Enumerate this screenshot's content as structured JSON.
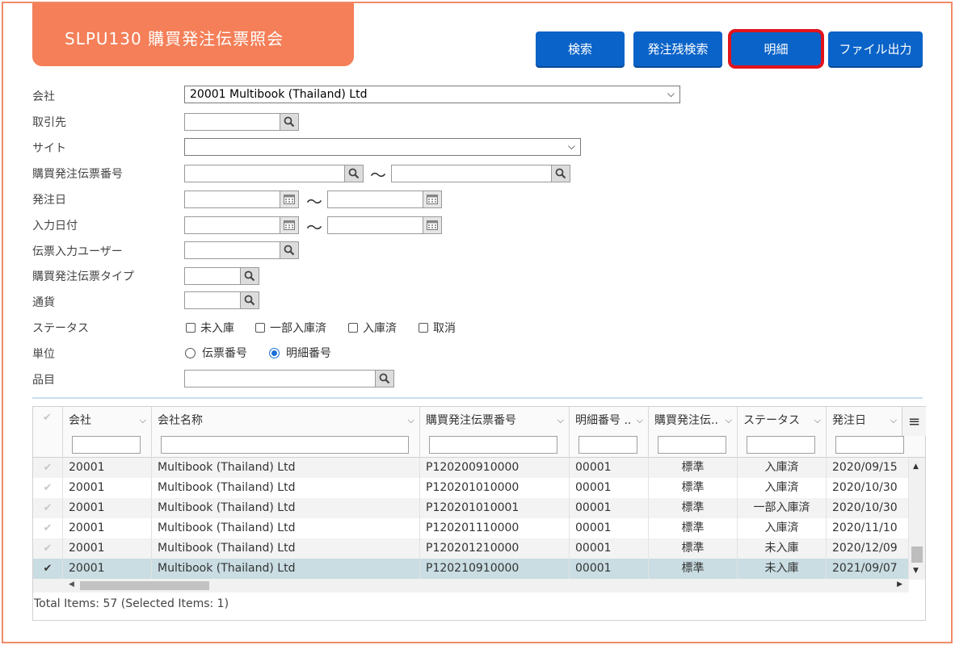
{
  "title": "SLPU130 購買発注伝票照会",
  "toolbar": {
    "search": "検索",
    "remaining_search": "発注残検索",
    "detail": "明細",
    "file_output": "ファイル出力"
  },
  "form": {
    "company_label": "会社",
    "company_value": "20001 Multibook (Thailand) Ltd",
    "supplier_label": "取引先",
    "site_label": "サイト",
    "po_number_label": "購買発注伝票番号",
    "order_date_label": "発注日",
    "entry_date_label": "入力日付",
    "entry_user_label": "伝票入力ユーザー",
    "po_type_label": "購買発注伝票タイプ",
    "currency_label": "通貨",
    "status_label": "ステータス",
    "status_options": [
      "未入庫",
      "一部入庫済",
      "入庫済",
      "取消"
    ],
    "unit_label": "単位",
    "unit_options": [
      "伝票番号",
      "明細番号"
    ],
    "unit_selected": "明細番号",
    "item_label": "品目",
    "range_sep": "〜"
  },
  "grid": {
    "columns": [
      "会社",
      "会社名称",
      "購買発注伝票番号",
      "明細番号 ..",
      "購買発注伝..",
      "ステータス",
      "発注日"
    ],
    "rows": [
      {
        "company": "20001",
        "name": "Multibook (Thailand) Ltd",
        "po": "P120200910000",
        "line": "00001",
        "type": "標準",
        "status": "入庫済",
        "date": "2020/09/15",
        "selected": false
      },
      {
        "company": "20001",
        "name": "Multibook (Thailand) Ltd",
        "po": "P120201010000",
        "line": "00001",
        "type": "標準",
        "status": "入庫済",
        "date": "2020/10/30",
        "selected": false
      },
      {
        "company": "20001",
        "name": "Multibook (Thailand) Ltd",
        "po": "P120201010001",
        "line": "00001",
        "type": "標準",
        "status": "一部入庫済",
        "date": "2020/10/30",
        "selected": false
      },
      {
        "company": "20001",
        "name": "Multibook (Thailand) Ltd",
        "po": "P120201110000",
        "line": "00001",
        "type": "標準",
        "status": "入庫済",
        "date": "2020/11/10",
        "selected": false
      },
      {
        "company": "20001",
        "name": "Multibook (Thailand) Ltd",
        "po": "P120201210000",
        "line": "00001",
        "type": "標準",
        "status": "未入庫",
        "date": "2020/12/09",
        "selected": false
      },
      {
        "company": "20001",
        "name": "Multibook (Thailand) Ltd",
        "po": "P120210910000",
        "line": "00001",
        "type": "標準",
        "status": "未入庫",
        "date": "2021/09/07",
        "selected": true
      }
    ],
    "footer": "Total Items: 57 (Selected Items: 1)"
  },
  "icons": {
    "search": "magnifier-icon",
    "calendar": "calendar-icon",
    "menu": "hamburger-menu-icon",
    "check": "checkmark-icon"
  },
  "colors": {
    "title_bg": "#f47f58",
    "button_bg": "#0a63c8",
    "highlight": "#e3131b",
    "selected_row": "#c9dde3"
  }
}
